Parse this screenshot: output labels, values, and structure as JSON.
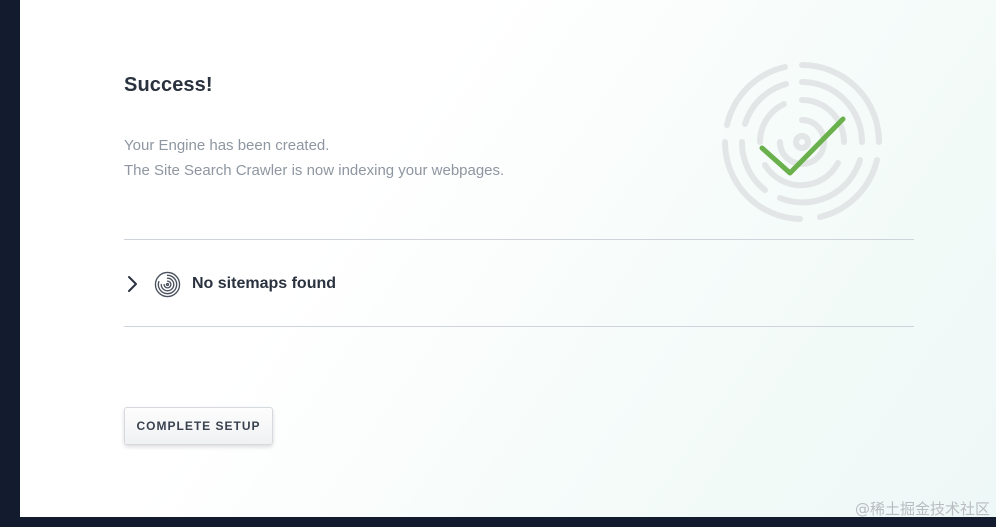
{
  "success": {
    "title": "Success!",
    "line1": "Your Engine has been created.",
    "line2": "The Site Search Crawler is now indexing your webpages."
  },
  "sitemaps": {
    "label": "No sitemaps found",
    "chevron_icon": "chevron-right-icon",
    "status_icon": "fingerprint-icon"
  },
  "actions": {
    "complete_label": "COMPLETE SETUP"
  },
  "badge": {
    "icon": "checkmark-icon",
    "check_color": "#6ab04c",
    "ring_color": "#e3e6e6"
  },
  "watermark": "@稀土掘金技术社区"
}
